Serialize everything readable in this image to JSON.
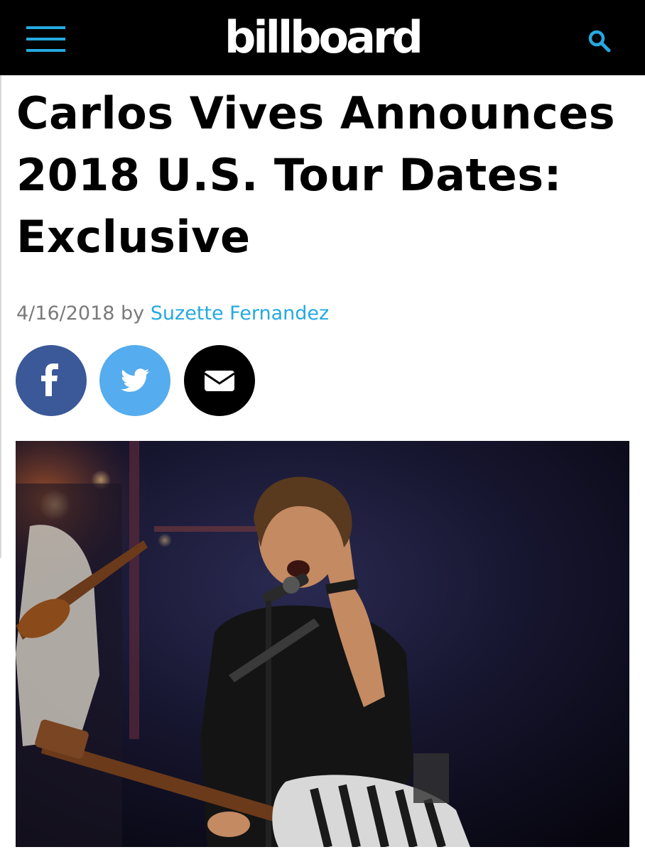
{
  "header": {
    "logo_text": "billboard",
    "menu_icon": "hamburger-menu-icon",
    "search_icon": "search-icon",
    "background_color": "#000000",
    "accent_color": "#26a9e0"
  },
  "article": {
    "title": "Carlos Vives Announces 2018 U.S. Tour Dates: Exclusive",
    "date": "4/16/2018",
    "by": "by",
    "author": "Suzette Fernandez"
  },
  "share": [
    {
      "network": "Facebook",
      "icon": "facebook-icon",
      "color": "#3b5998"
    },
    {
      "network": "Twitter",
      "icon": "twitter-icon",
      "color": "#55acee"
    },
    {
      "network": "Email",
      "icon": "email-icon",
      "color": "#000000"
    }
  ]
}
